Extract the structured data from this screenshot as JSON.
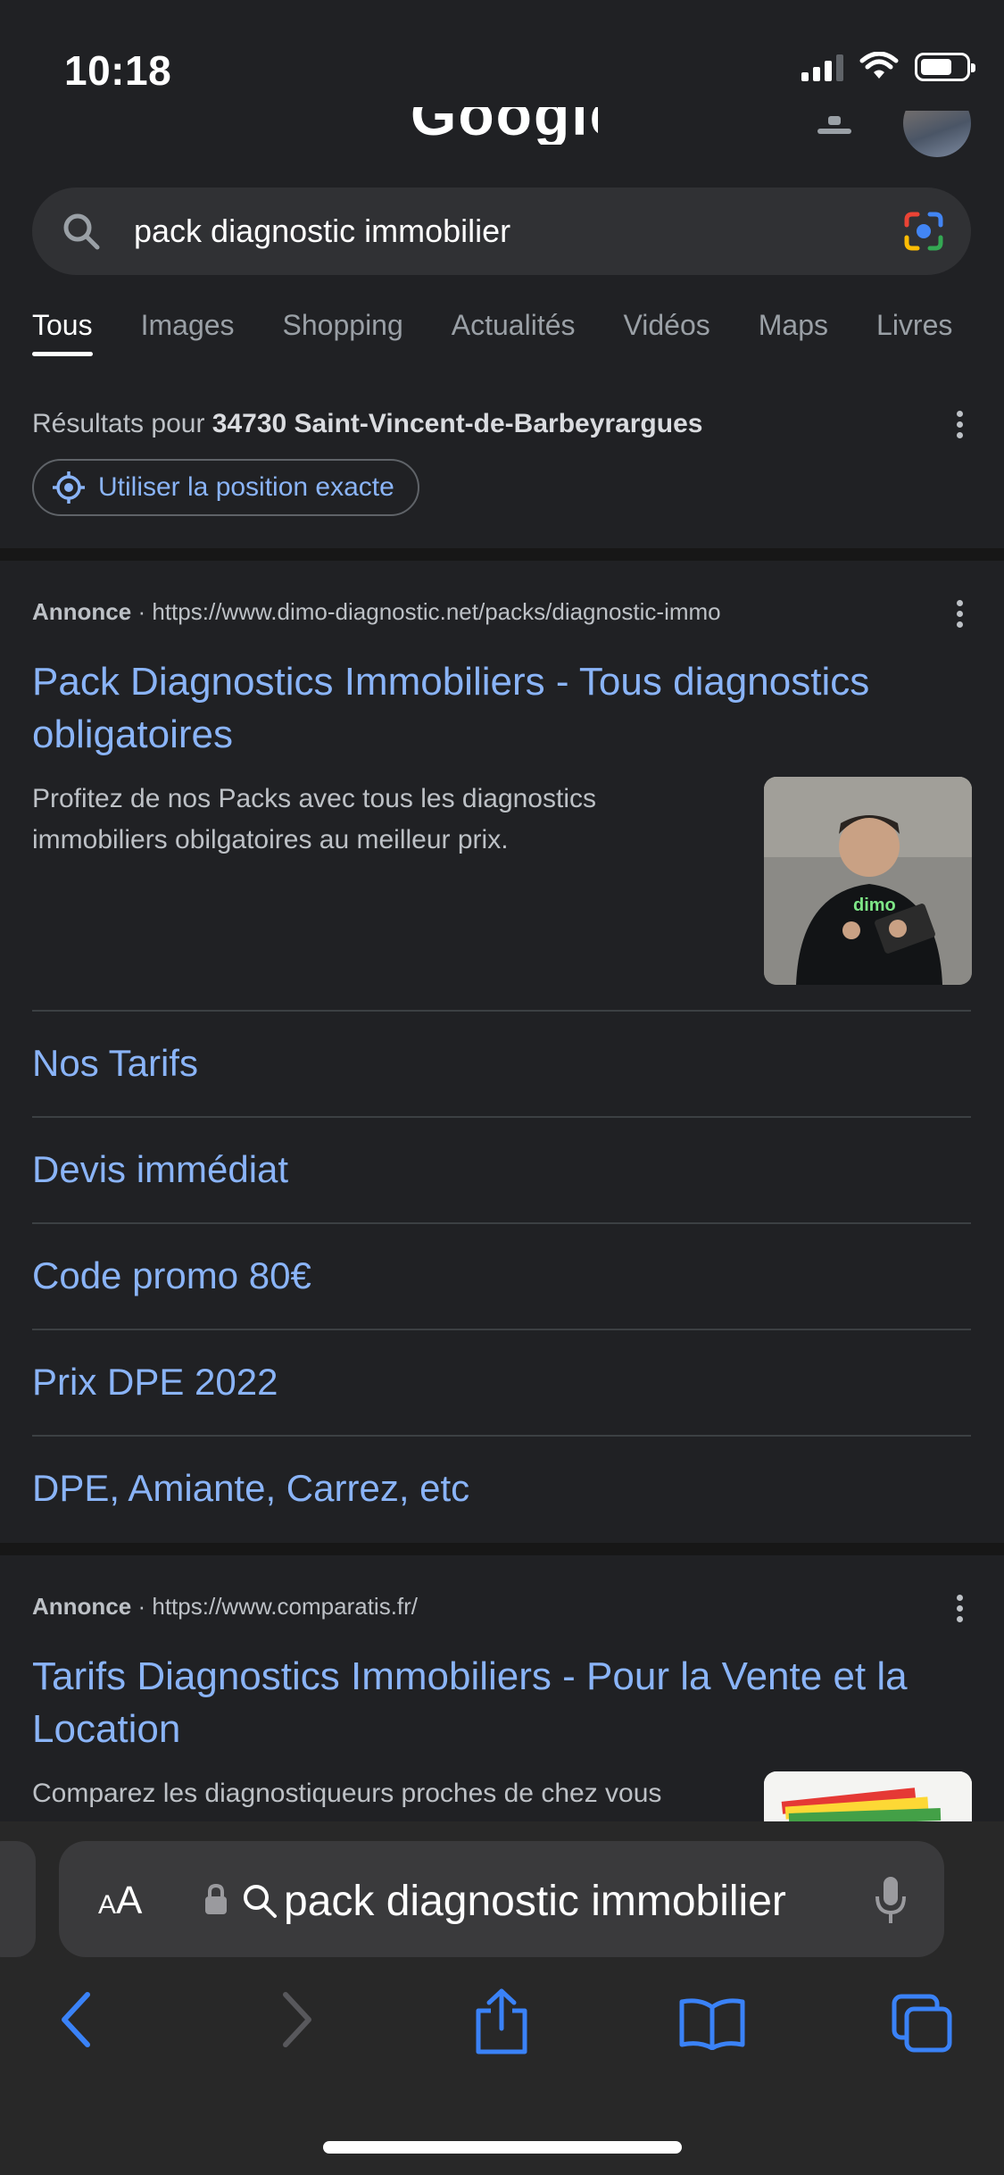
{
  "status": {
    "time": "10:18"
  },
  "search": {
    "query": "pack diagnostic immobilier"
  },
  "tabs": [
    {
      "label": "Tous",
      "active": true
    },
    {
      "label": "Images"
    },
    {
      "label": "Shopping"
    },
    {
      "label": "Actualités"
    },
    {
      "label": "Vidéos"
    },
    {
      "label": "Maps"
    },
    {
      "label": "Livres"
    }
  ],
  "location": {
    "prefix": "Résultats pour ",
    "place": "34730 Saint-Vincent-de-Barbeyrargues",
    "button_label": "Utiliser la position exacte"
  },
  "ad1": {
    "label": "Annonce",
    "separator": "·",
    "url": "https://www.dimo-diagnostic.net/packs/diagnostic-immo",
    "title": "Pack Diagnostics Immobiliers - Tous diagnostics obligatoires",
    "description": "Profitez de nos Packs avec tous les diagnostics immobiliers obilgatoires au meilleur prix.",
    "image_text": "dimo",
    "sitelinks": [
      "Nos Tarifs",
      "Devis immédiat",
      "Code promo 80€",
      "Prix DPE 2022",
      "DPE, Amiante, Carrez, etc"
    ]
  },
  "ad2": {
    "label": "Annonce",
    "separator": "·",
    "url": "https://www.comparatis.fr/",
    "title": "Tarifs Diagnostics Immobiliers - Pour la Vente et la Location",
    "description": "Comparez les diagnostiqueurs proches de chez vous"
  },
  "safari": {
    "aa_small": "A",
    "aa_big": "A",
    "url_text": "pack diagnostic immobilier"
  },
  "colors": {
    "link": "#8ab4f8",
    "background": "#202124",
    "text_secondary": "#bdc1c6"
  }
}
